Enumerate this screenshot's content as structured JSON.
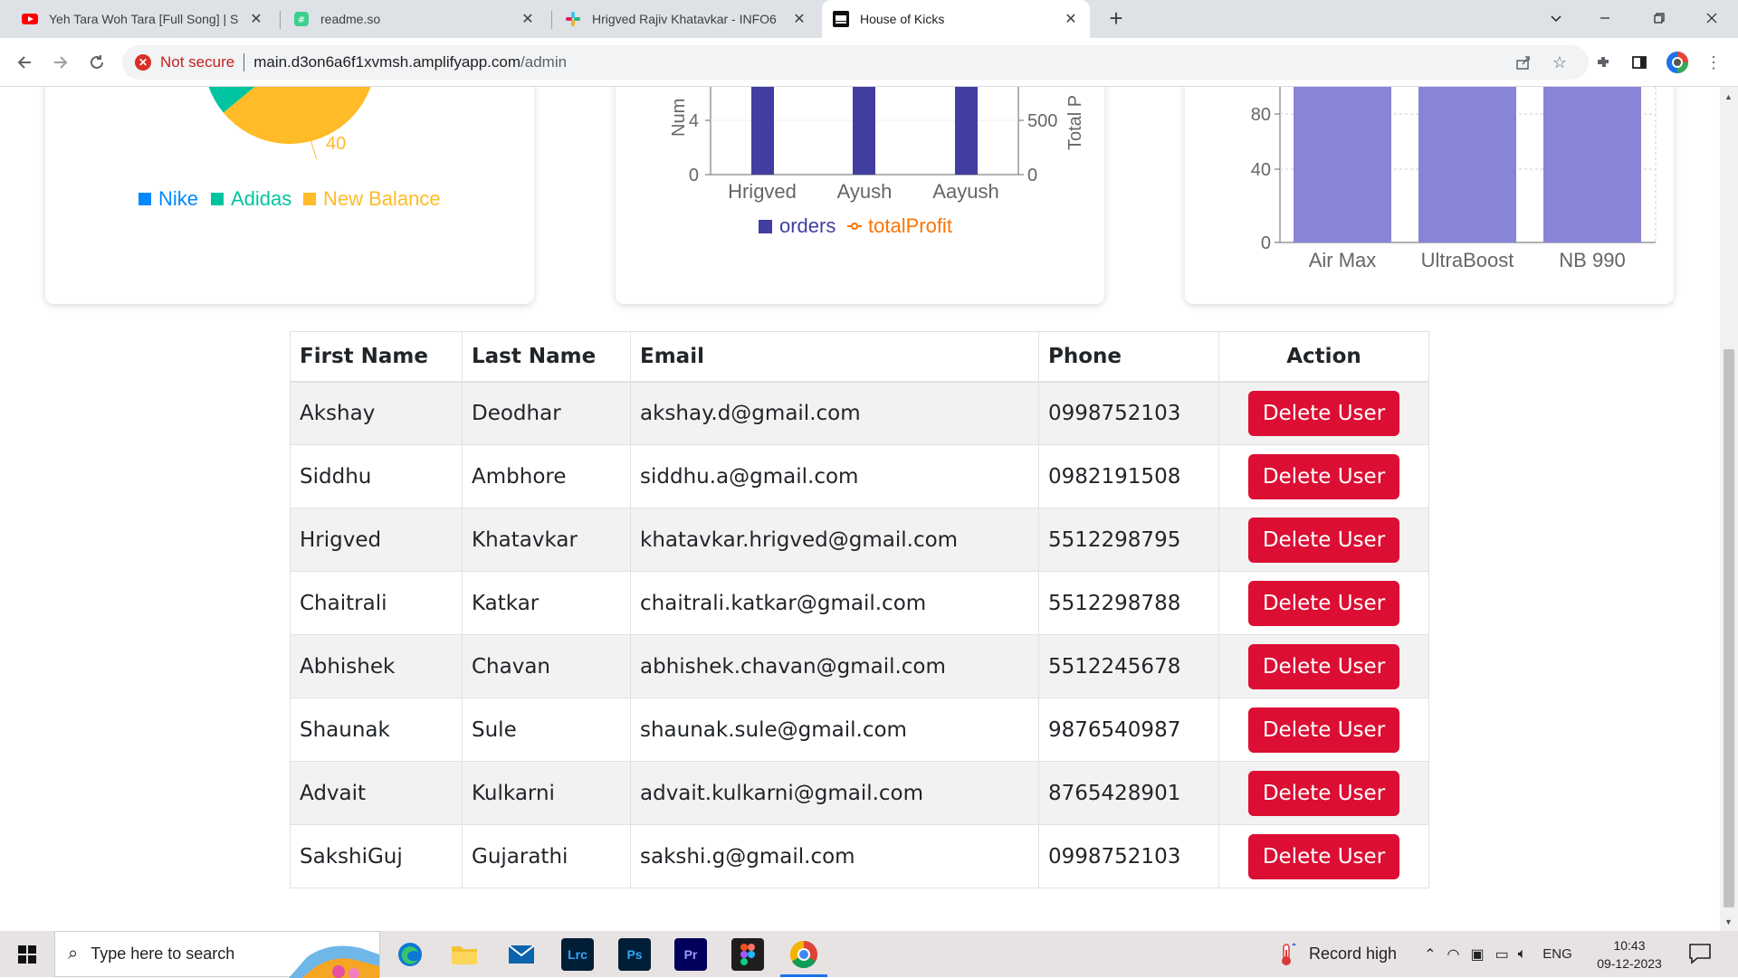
{
  "browser": {
    "tabs": [
      {
        "title": "Yeh Tara Woh Tara [Full Song] | S",
        "icon": "youtube-icon"
      },
      {
        "title": "readme.so",
        "icon": "readme-icon"
      },
      {
        "title": "Hrigved Rajiv Khatavkar - INFO6",
        "icon": "slack-icon"
      },
      {
        "title": "House of Kicks",
        "icon": "house-of-kicks-icon",
        "active": true
      }
    ],
    "security_label": "Not secure",
    "url_host": "main.d3on6a6f1xvmsh.amplifyapp.com",
    "url_path": "/admin"
  },
  "dashboard": {
    "brand_pie": {
      "legend": [
        "Nike",
        "Adidas",
        "New Balance"
      ],
      "colors": [
        "#0088fe",
        "#00c49f",
        "#ffbb28"
      ],
      "visible_label": "40"
    },
    "orders_chart": {
      "left_axis_label": "Num",
      "right_axis_label": "Total P",
      "legend_orders": "orders",
      "legend_profit": "totalProfit",
      "bar_color": "#413ea0",
      "profit_color": "#ff7300"
    },
    "product_chart": {
      "bar_color": "#8884d8"
    }
  },
  "chart_data": [
    {
      "type": "pie",
      "legend": [
        "Nike",
        "Adidas",
        "New Balance"
      ],
      "labels_visible": [
        "40"
      ]
    },
    {
      "type": "bar",
      "categories": [
        "Hrigved",
        "Ayush",
        "Aayush"
      ],
      "series": [
        {
          "name": "orders"
        },
        {
          "name": "totalProfit"
        }
      ],
      "left_ticks": [
        "0",
        "4"
      ],
      "right_ticks": [
        "0",
        "500"
      ],
      "xlabel": "",
      "ylabel": "Num",
      "ylabel_right": "Total P"
    },
    {
      "type": "bar",
      "categories": [
        "Air Max",
        "UltraBoost",
        "NB 990"
      ],
      "y_ticks": [
        "0",
        "40",
        "80"
      ]
    }
  ],
  "users_table": {
    "headers": [
      "First Name",
      "Last Name",
      "Email",
      "Phone",
      "Action"
    ],
    "action_label": "Delete User",
    "rows": [
      {
        "first": "Akshay",
        "last": "Deodhar",
        "email": "akshay.d@gmail.com",
        "phone": "0998752103"
      },
      {
        "first": "Siddhu",
        "last": "Ambhore",
        "email": "siddhu.a@gmail.com",
        "phone": "0982191508"
      },
      {
        "first": "Hrigved",
        "last": "Khatavkar",
        "email": "khatavkar.hrigved@gmail.com",
        "phone": "5512298795"
      },
      {
        "first": "Chaitrali",
        "last": "Katkar",
        "email": "chaitrali.katkar@gmail.com",
        "phone": "5512298788"
      },
      {
        "first": "Abhishek",
        "last": "Chavan",
        "email": "abhishek.chavan@gmail.com",
        "phone": "5512245678"
      },
      {
        "first": "Shaunak",
        "last": "Sule",
        "email": "shaunak.sule@gmail.com",
        "phone": "9876540987"
      },
      {
        "first": "Advait",
        "last": "Kulkarni",
        "email": "advait.kulkarni@gmail.com",
        "phone": "8765428901"
      },
      {
        "first": "SakshiGuj",
        "last": "Gujarathi",
        "email": "sakshi.g@gmail.com",
        "phone": "0998752103"
      }
    ]
  },
  "taskbar": {
    "search_placeholder": "Type here to search",
    "weather": "Record high",
    "language": "ENG",
    "time": "10:43",
    "date": "09-12-2023",
    "apps": [
      "edge-icon",
      "file-explorer-icon",
      "mail-icon",
      "lightroom-icon",
      "photoshop-icon",
      "premiere-icon",
      "figma-icon",
      "chrome-icon"
    ]
  }
}
